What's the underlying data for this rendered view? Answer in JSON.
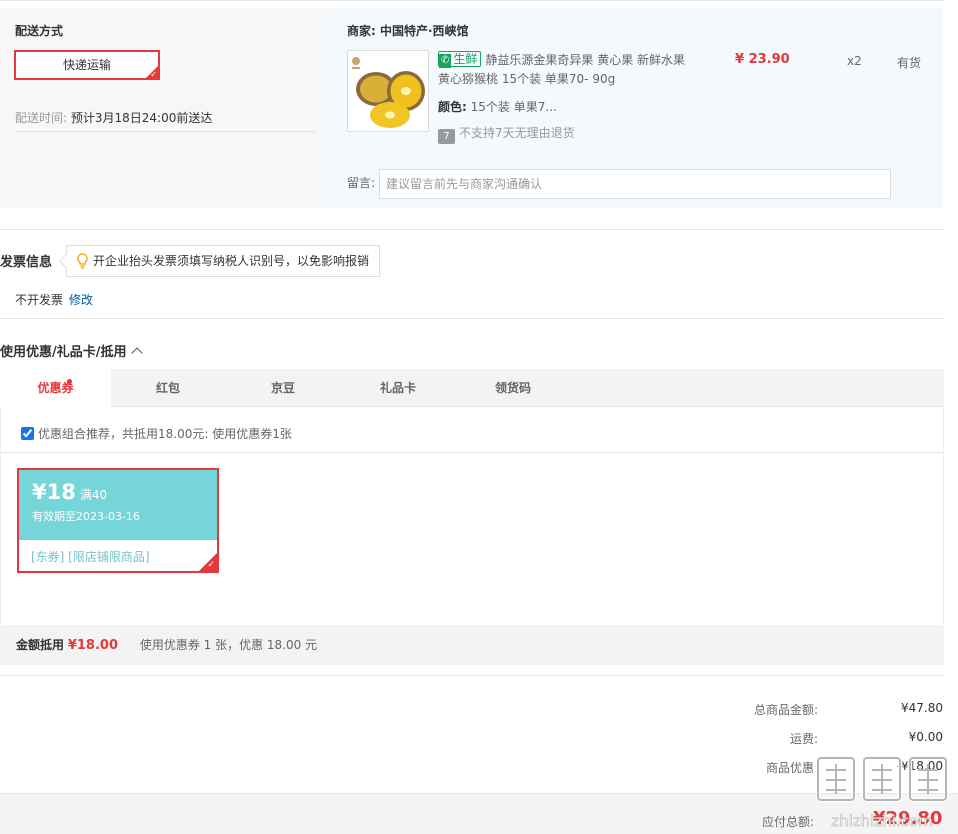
{
  "delivery": {
    "title": "配送方式",
    "method": "快递运输",
    "time_label": "配送时间:",
    "time_value": "预计3月18日24:00前送达"
  },
  "store": {
    "name": "商家: 中国特产·西峡馆",
    "product": {
      "fresh_tag": "生鲜",
      "title": "静益乐源金果奇异果 黄心果 新鲜水果 黄心猕猴桃 15个装 单果70- 90g",
      "color_label": "颜色:",
      "color_value": "15个装 单果7...",
      "return_icon": "7",
      "return_note": "不支持7天无理由退货",
      "price": "¥ 23.90",
      "qty": "x2",
      "stock": "有货"
    },
    "message_label": "留言:",
    "message_placeholder": "建议留言前先与商家沟通确认"
  },
  "invoice": {
    "title": "发票信息",
    "tip": "开企业抬头发票须填写纳税人识别号，以免影响报销",
    "status": "不开发票",
    "edit_label": "修改"
  },
  "coupons": {
    "title": "使用优惠/礼品卡/抵用",
    "tabs": [
      {
        "label": "优惠券",
        "active": true
      },
      {
        "label": "红包",
        "active": false
      },
      {
        "label": "京豆",
        "active": false
      },
      {
        "label": "礼品卡",
        "active": false
      },
      {
        "label": "领货码",
        "active": false
      }
    ],
    "recommend_text": "优惠组合推荐，共抵用18.00元: 使用优惠券1张",
    "recommend_checked": true,
    "card": {
      "amount": "¥18",
      "condition": "满40",
      "valid": "有效期至2023-03-16",
      "tags": "[东券] [限店铺限商品]"
    },
    "summary_label": "金额抵用",
    "summary_amount": "¥18.00",
    "summary_text": "使用优惠券 1 张，优惠 18.00 元"
  },
  "totals": {
    "goods_label": "总商品金额:",
    "goods_value": "¥47.80",
    "shipping_label": "运费:",
    "shipping_value": "¥0.00",
    "discount_label": "商品优惠:",
    "discount_value": "-¥18.00",
    "payable_label": "应付总额:",
    "payable_value": "¥29.80"
  },
  "watermark": "值 什么值得买 zhizhizhi.com",
  "colors": {
    "accent_red": "#e4393c",
    "coupon_teal": "#76d5d9",
    "fresh_green": "#1aa260",
    "link_blue": "#005aa0",
    "store_bg": "#f3f9fd"
  }
}
